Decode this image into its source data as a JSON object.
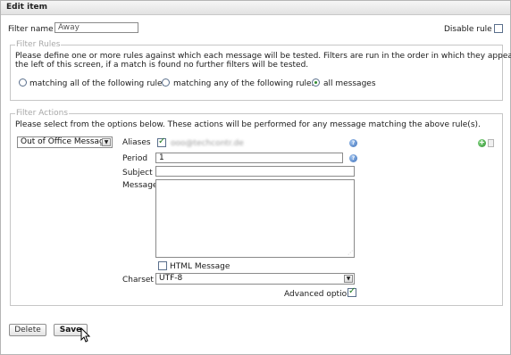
{
  "window": {
    "title": "Edit item"
  },
  "filter": {
    "name_label": "Filter name",
    "name_value": "Away",
    "disable_label": "Disable rule",
    "disable_checked": false
  },
  "rules": {
    "legend": "Filter Rules",
    "description_line1": "Please define one or more rules against which each message will be tested. Filters are run in the order in which they appear on",
    "description_line2": "the left of this screen, if a match is found no further filters will be tested.",
    "options": [
      {
        "label": "matching all of the following rules",
        "checked": false
      },
      {
        "label": "matching any of the following rules",
        "checked": false
      },
      {
        "label": "all messages",
        "checked": true
      }
    ]
  },
  "actions": {
    "legend": "Filter Actions",
    "description": "Please select from the options below. These actions will be performed for any message matching the above rule(s).",
    "action_select": "Out of Office Message",
    "aliases_label": "Aliases",
    "alias_checked": true,
    "alias_value": "ooo@techcontr.de",
    "period_label": "Period",
    "period_value": "1",
    "subject_label": "Subject",
    "subject_value": "",
    "message_label": "Message",
    "message_value": "",
    "html_label": "HTML Message",
    "html_checked": false,
    "charset_label": "Charset",
    "charset_value": "UTF-8",
    "advanced_label": "Advanced options",
    "advanced_checked": true
  },
  "buttons": {
    "delete": "Delete",
    "save": "Save"
  },
  "icons": {
    "help": "help-icon",
    "add": "add-icon",
    "delete_row": "trash-icon",
    "cursor": "mouse-pointer-icon"
  }
}
